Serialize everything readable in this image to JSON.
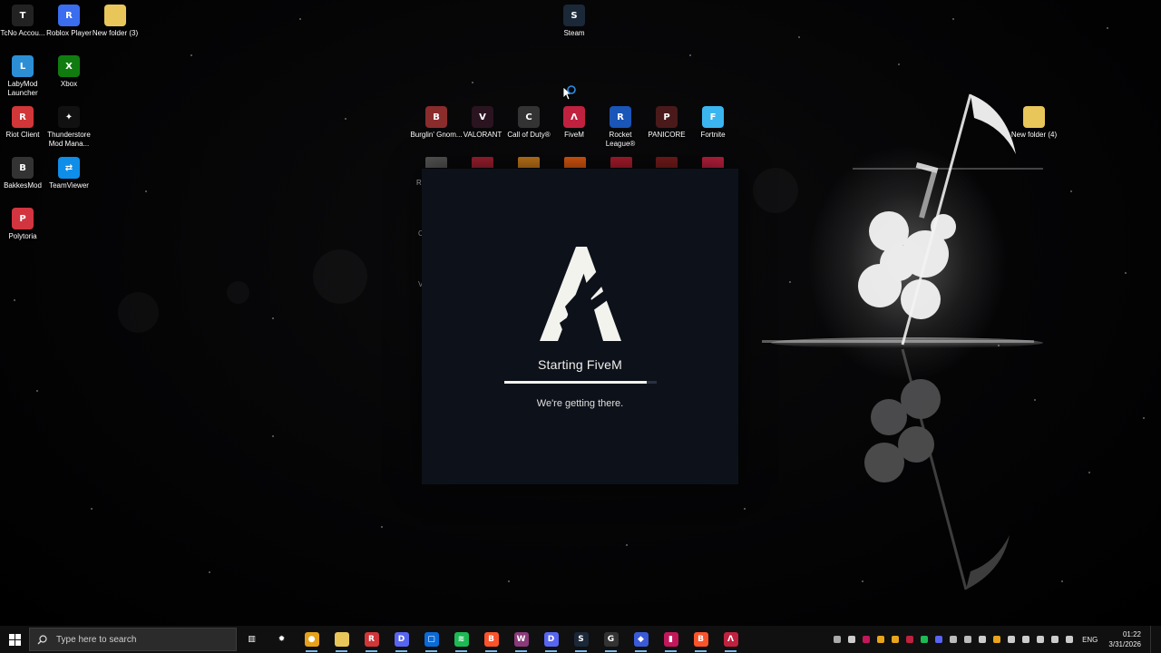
{
  "desktop_icons": [
    {
      "label": "TcNo Accou...",
      "icon": "tcno-icon",
      "color": "#222",
      "glyph": "T"
    },
    {
      "label": "Roblox Player",
      "icon": "roblox-icon",
      "color": "#3a6df0",
      "glyph": "R"
    },
    {
      "label": "New folder (3)",
      "icon": "folder-icon",
      "color": "#e8c65a",
      "glyph": ""
    },
    {
      "label": "Steam",
      "icon": "steam-icon",
      "color": "#1b2838",
      "glyph": "S"
    },
    {
      "label": "LabyMod Launcher",
      "icon": "labymod-icon",
      "color": "#2c8fd6",
      "glyph": "L"
    },
    {
      "label": "Xbox",
      "icon": "xbox-icon",
      "color": "#107c10",
      "glyph": "X"
    },
    {
      "label": "Riot Client",
      "icon": "riot-icon",
      "color": "#d13639",
      "glyph": "R"
    },
    {
      "label": "Thunderstore Mod Mana...",
      "icon": "thunderstore-icon",
      "color": "#111",
      "glyph": "✦"
    },
    {
      "label": "BakkesMod",
      "icon": "bakkesmod-icon",
      "color": "#333",
      "glyph": "B"
    },
    {
      "label": "TeamViewer",
      "icon": "teamviewer-icon",
      "color": "#0e8ee9",
      "glyph": "⇄"
    },
    {
      "label": "Polytoria",
      "icon": "polytoria-icon",
      "color": "#d2353f",
      "glyph": "P"
    },
    {
      "label": "Burglin' Gnom...",
      "icon": "burglin-gnomes-icon",
      "color": "#8a2c2c",
      "glyph": "B"
    },
    {
      "label": "VALORANT",
      "icon": "valorant-icon",
      "color": "#2a1420",
      "glyph": "V"
    },
    {
      "label": "Call of Duty®",
      "icon": "call-of-duty-icon",
      "color": "#333",
      "glyph": "C"
    },
    {
      "label": "FiveM",
      "icon": "fivem-icon",
      "color": "#c0213f",
      "glyph": "Λ"
    },
    {
      "label": "Rocket League®",
      "icon": "rocket-league-icon",
      "color": "#1a55b8",
      "glyph": "R"
    },
    {
      "label": "PANICORE",
      "icon": "panicore-icon",
      "color": "#4a1a1a",
      "glyph": "P"
    },
    {
      "label": "Fortnite",
      "icon": "fortnite-icon",
      "color": "#3bb5f0",
      "glyph": "F"
    },
    {
      "label": "New folder (4)",
      "icon": "folder-icon",
      "color": "#e8c65a",
      "glyph": ""
    }
  ],
  "partial_icons": [
    {
      "icon": "partial-icon-1",
      "color": "#555"
    },
    {
      "icon": "partial-icon-2",
      "color": "#a02030"
    },
    {
      "icon": "partial-icon-3",
      "color": "#c67a1a"
    },
    {
      "icon": "partial-icon-4",
      "color": "#e05a10"
    },
    {
      "icon": "partial-icon-5",
      "color": "#b01c2e"
    },
    {
      "icon": "partial-icon-6",
      "color": "#7a1c1c"
    },
    {
      "icon": "partial-icon-7",
      "color": "#c0213f"
    }
  ],
  "ghost_labels": [
    "R",
    "C",
    "V"
  ],
  "splash": {
    "title": "Starting FiveM",
    "subtitle": "We're getting there.",
    "progress": 0.94,
    "brand_color": "#f3f3ee"
  },
  "taskbar": {
    "search_placeholder": "Type here to search",
    "apps": [
      {
        "icon": "task-view-icon",
        "color": "transparent",
        "glyph": "▥"
      },
      {
        "icon": "steelseries-icon",
        "color": "transparent",
        "glyph": "✹"
      },
      {
        "icon": "chrome-icon",
        "color": "#e6a21a",
        "glyph": "●"
      },
      {
        "icon": "file-explorer-icon",
        "color": "#e8c65a",
        "glyph": ""
      },
      {
        "icon": "riot-client-icon",
        "color": "#d13639",
        "glyph": "R"
      },
      {
        "icon": "discord-ptb-icon",
        "color": "#5865f2",
        "glyph": "D"
      },
      {
        "icon": "store-icon",
        "color": "#0a6bd8",
        "glyph": "▢"
      },
      {
        "icon": "spotify-icon",
        "color": "#1db954",
        "glyph": "≋"
      },
      {
        "icon": "brave-icon",
        "color": "#fb542b",
        "glyph": "B"
      },
      {
        "icon": "winrar-icon",
        "color": "#8a3a7a",
        "glyph": "W"
      },
      {
        "icon": "discord-icon",
        "color": "#5865f2",
        "glyph": "D"
      },
      {
        "icon": "steam-icon",
        "color": "#1b2838",
        "glyph": "S"
      },
      {
        "icon": "github-icon",
        "color": "#333",
        "glyph": "G"
      },
      {
        "icon": "game-controller-icon",
        "color": "#3a5ad8",
        "glyph": "◆"
      },
      {
        "icon": "app-icon",
        "color": "#c2185b",
        "glyph": "▮"
      },
      {
        "icon": "brave-alt-icon",
        "color": "#fb542b",
        "glyph": "B"
      },
      {
        "icon": "fivem-icon",
        "color": "#c0213f",
        "glyph": "Λ"
      }
    ],
    "tray_icons": [
      {
        "icon": "tray-icon-1",
        "color": "#aaa"
      },
      {
        "icon": "headset-icon",
        "color": "#ccc"
      },
      {
        "icon": "tray-icon-3",
        "color": "#c2185b"
      },
      {
        "icon": "tray-icon-4",
        "color": "#e8a41a"
      },
      {
        "icon": "tray-icon-5",
        "color": "#e8a41a"
      },
      {
        "icon": "tray-icon-6",
        "color": "#c0213f"
      },
      {
        "icon": "tray-icon-7",
        "color": "#1db954"
      },
      {
        "icon": "tray-icon-8",
        "color": "#5865f2"
      },
      {
        "icon": "tray-icon-9",
        "color": "#bbb"
      },
      {
        "icon": "tray-steam-icon",
        "color": "#bbb"
      },
      {
        "icon": "microphone-icon",
        "color": "#ccc"
      },
      {
        "icon": "tray-icon-12",
        "color": "#e8a41a"
      },
      {
        "icon": "settings-icon",
        "color": "#ccc"
      },
      {
        "icon": "volume-icon",
        "color": "#ccc"
      },
      {
        "icon": "speaker-icon",
        "color": "#ccc"
      },
      {
        "icon": "network-icon",
        "color": "#ccc"
      },
      {
        "icon": "battery-icon",
        "color": "#ccc"
      }
    ],
    "language": "ENG",
    "time": "01:22",
    "date": "3/31/2026"
  }
}
